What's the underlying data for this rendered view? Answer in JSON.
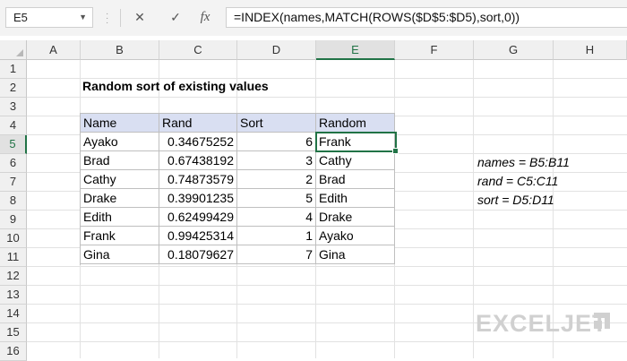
{
  "formula_bar": {
    "name_box": "E5",
    "cancel_icon": "✕",
    "enter_icon": "✓",
    "fx_label": "fx",
    "formula": "=INDEX(names,MATCH(ROWS($D$5:$D5),sort,0))"
  },
  "columns": [
    "A",
    "B",
    "C",
    "D",
    "E",
    "F",
    "G",
    "H"
  ],
  "active_column": "E",
  "rows": [
    "1",
    "2",
    "3",
    "4",
    "5",
    "6",
    "7",
    "8",
    "9",
    "10",
    "11",
    "12",
    "13",
    "14",
    "15",
    "16"
  ],
  "active_row": "5",
  "sheet": {
    "title": "Random sort of existing values",
    "table": {
      "headers": [
        "Name",
        "Rand",
        "Sort",
        "Random"
      ],
      "rows": [
        [
          "Ayako",
          "0.34675252",
          "6",
          "Frank"
        ],
        [
          "Brad",
          "0.67438192",
          "3",
          "Cathy"
        ],
        [
          "Cathy",
          "0.74873579",
          "2",
          "Brad"
        ],
        [
          "Drake",
          "0.39901235",
          "5",
          "Edith"
        ],
        [
          "Edith",
          "0.62499429",
          "4",
          "Drake"
        ],
        [
          "Frank",
          "0.99425314",
          "1",
          "Ayako"
        ],
        [
          "Gina",
          "0.18079627",
          "7",
          "Gina"
        ]
      ]
    },
    "notes": [
      "names = B5:B11",
      "rand = C5:C11",
      "sort = D5:D11"
    ]
  },
  "watermark": {
    "text": "EXCELJET",
    "color": "#d0d0d0"
  },
  "colors": {
    "accent": "#217346",
    "header_fill": "#d9dff2"
  }
}
